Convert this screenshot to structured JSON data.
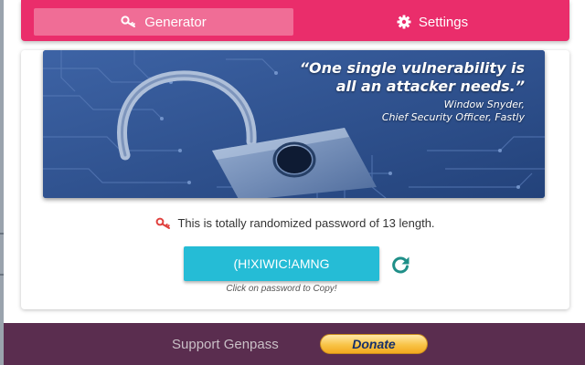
{
  "tabs": {
    "generator_label": "Generator",
    "settings_label": "Settings"
  },
  "banner": {
    "quote_line1": "“One single vulnerability is",
    "quote_line2": "all an attacker needs.”",
    "author_name": "Window Snyder,",
    "author_title": "Chief Security Officer, Fastly"
  },
  "info_text": "This is totally randomized password of 13 length.",
  "password": "(H!XIWIC!AMNG",
  "copy_hint": "Click on password to Copy!",
  "footer": {
    "support_text": "Support Genpass",
    "donate_label": "Donate"
  },
  "icons": {
    "generator": "key-icon",
    "settings": "gear-icon",
    "info": "key-icon",
    "refresh": "refresh-icon"
  },
  "colors": {
    "topbar": "#ea2d6b",
    "active_tab": "#f06d96",
    "password_button": "#25bcd6",
    "refresh": "#1f8f88",
    "footer": "#5a2d4f",
    "info_key": "#e0413e"
  }
}
